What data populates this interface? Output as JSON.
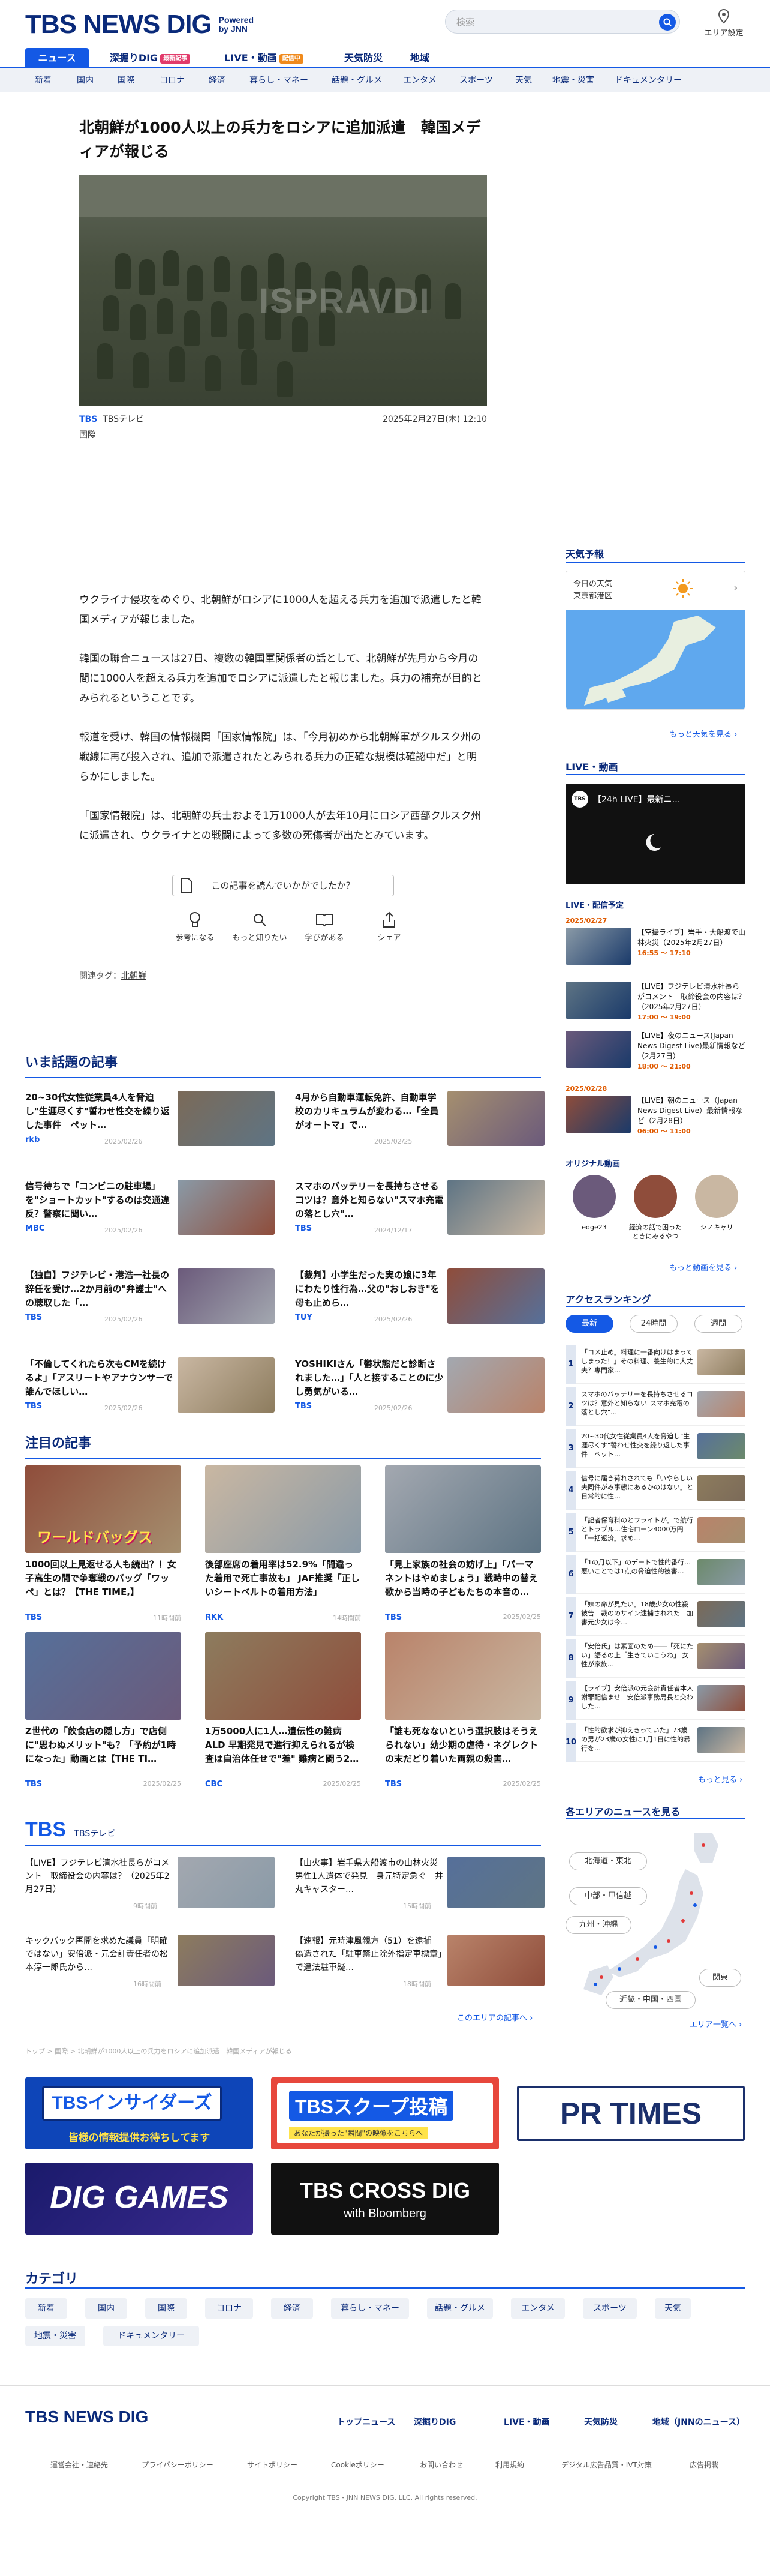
{
  "header": {
    "logo": "TBS NEWS DIG",
    "powered": "Powered by JNN",
    "search_placeholder": "検索",
    "area_label": "エリア設定"
  },
  "main_nav": [
    {
      "label": "ニュース"
    },
    {
      "label": "深掘りDIG",
      "badge": "最新記事"
    },
    {
      "label": "LIVE・動画",
      "badge": "配信中"
    },
    {
      "label": "天気防災"
    },
    {
      "label": "地域"
    }
  ],
  "sub_nav": [
    "新着",
    "国内",
    "国際",
    "コロナ",
    "経済",
    "暮らし・マネー",
    "話題・グルメ",
    "エンタメ",
    "スポーツ",
    "天気",
    "地震・災害",
    "ドキュメンタリー"
  ],
  "article": {
    "title": "北朝鮮が1000人以上の兵力をロシアに追加派遣　韓国メディアが報じる",
    "photo_watermark": "ISPRAVDI",
    "source": "TBSテレビ",
    "source_logo": "TBS",
    "date": "2025年2月27日(木) 12:10",
    "category": "国際",
    "paragraphs": [
      "ウクライナ侵攻をめぐり、北朝鮮がロシアに1000人を超える兵力を追加で派遣したと韓国メディアが報じました。",
      "韓国の聯合ニュースは27日、複数の韓国軍関係者の話として、北朝鮮が先月から今月の間に1000人を超える兵力を追加でロシアに派遣したと報じました。兵力の補充が目的とみられるということです。",
      "報道を受け、韓国の情報機関「国家情報院」は、「今月初めから北朝鮮軍がクルスク州の戦線に再び投入され、追加で派遣されたとみられる兵力の正確な規模は確認中だ」と明らかにしました。",
      "「国家情報院」は、北朝鮮の兵士およそ1万1000人が去年10月にロシア西部クルスク州に派遣され、ウクライナとの戦闘によって多数の死傷者が出たとみています。"
    ]
  },
  "feedback": {
    "question": "この記事を読んでいかがでしたか？",
    "options": [
      "参考になる",
      "もっと知りたい",
      "学びがある",
      "シェア"
    ]
  },
  "tags": {
    "label": "関連タグ：",
    "items": [
      "北朝鮮"
    ]
  },
  "trending": {
    "title": "いま話題の記事",
    "items": [
      {
        "title": "20~30代女性従業員4人を脅迫し\"生涯尽くす\"誓わせ性交を繰り返した事件　ペット…",
        "source": "rkb",
        "date": "2025/02/26"
      },
      {
        "title": "4月から自動車運転免許、自動車学校のカリキュラムが変わる…「全員がオートマ」で…",
        "source": "",
        "date": "2025/02/25"
      },
      {
        "title": "信号待ちで「コンビニの駐車場」を\"ショートカット\"するのは交通違反？警察に聞い…",
        "source": "MBC",
        "date": "2025/02/26"
      },
      {
        "title": "スマホのバッテリーを長持ちさせるコツは？意外と知らない\"スマホ充電の落とし穴\"…",
        "source": "TBS",
        "date": "2024/12/17"
      },
      {
        "title": "【独自】フジテレビ・港浩一社長の辞任を受け…2か月前の\"弁護士\"への聴取した「…",
        "source": "TBS",
        "date": "2025/02/26"
      },
      {
        "title": "【裁判】小学生だった実の娘に3年にわたり性行為…父の\"おしおき\"を母も止めら…",
        "source": "TUY",
        "date": "2025/02/26"
      },
      {
        "title": "「不倫してくれたら次もCMを続けるよ」「アスリートやアナウンサーで誰んでほしい…",
        "source": "TBS",
        "date": "2025/02/26"
      },
      {
        "title": "YOSHIKIさん「鬱状態だと診断されました…」「人と接することのに少し勇気がいる…",
        "source": "TBS",
        "date": "2025/02/26"
      }
    ]
  },
  "featured": {
    "title": "注目の記事",
    "items": [
      {
        "title": "1000回以上見返せる人も続出？！女子高生の間で争奪戦のバッグ「ワッペ」とは？【THE TIME,】",
        "source": "TBS",
        "date": "11時間前",
        "overlay": "ワールドバッグス"
      },
      {
        "title": "後部座席の着用率は52.9%「間違った着用で死亡事故も」 JAF推奨「正しいシートベルトの着用方法」",
        "source": "RKK",
        "date": "14時間前",
        "overlay": ""
      },
      {
        "title": "「見上家族の社会の妨げ上」「パーマネントはやめましょう」戦時中の替え歌から当時の子どもたちの本音の…",
        "source": "TBS",
        "date": "2025/02/25",
        "overlay": ""
      },
      {
        "title": "Z世代の「飲食店の隠し方」で店側に\"思わぬメリット\"も？「予約が1時になった」動画とは【THE TI…",
        "source": "TBS",
        "date": "2025/02/25",
        "overlay": ""
      },
      {
        "title": "1万5000人に1人…遺伝性の難病ALD 早期発見で進行抑えられるが検査は自治体任せで\"差\" 難病と闘う2…",
        "source": "CBC",
        "date": "2025/02/25",
        "overlay": ""
      },
      {
        "title": "「誰も死なないという選択肢はそうえられない」幼少期の虐待・ネグレクトの末だどり着いた両親の殺害…",
        "source": "TBS",
        "date": "2025/02/25",
        "overlay": ""
      }
    ]
  },
  "tbs_section": {
    "logo": "TBS",
    "label": "TBSテレビ",
    "items": [
      {
        "title": "【LIVE】フジテレビ清水社長らがコメント　取締役会の内容は？（2025年2月27日）",
        "date": "9時間前"
      },
      {
        "title": "【山火事】岩手県大船渡市の山林火災　男性1人遺体で発見　身元特定急ぐ　井丸キャスター…",
        "date": "15時間前"
      },
      {
        "title": "キックバック再開を求めた議員「明確ではない」安倍派・元会計責任者の松本淳一郎氏から…",
        "date": "16時間前"
      },
      {
        "title": "【速報】元時津風親方（51）を逮捕　偽造された「駐車禁止除外指定車標章」で違法駐車疑…",
        "date": "18時間前"
      }
    ],
    "more": "このエリアの記事へ"
  },
  "breadcrumb": "トップ > 国際 > 北朝鮮が1000人以上の兵力をロシアに追加派遣　韓国メディアが報じる",
  "banners": [
    {
      "title": "TBSインサイダーズ",
      "sub": "皆様の情報提供お待ちしてます"
    },
    {
      "title": "TBSスクープ投稿",
      "sub": "あなたが撮った\"瞬間\"の映像をこちらへ"
    },
    {
      "title": "PR TIMES",
      "sub": ""
    },
    {
      "title": "DIG GAMES",
      "sub": ""
    },
    {
      "title": "TBS CROSS DIG",
      "sub": "with Bloomberg"
    }
  ],
  "categories": {
    "title": "カテゴリ",
    "items": [
      "新着",
      "国内",
      "国際",
      "コロナ",
      "経済",
      "暮らし・マネー",
      "話題・グルメ",
      "エンタメ",
      "スポーツ",
      "天気",
      "地震・災害",
      "ドキュメンタリー"
    ]
  },
  "sidebar": {
    "weather": {
      "title": "天気予報",
      "today": "今日の天気",
      "place": "東京都港区",
      "more": "もっと天気を見る"
    },
    "live": {
      "title": "LIVE・動画",
      "video_title": "【24h LIVE】最新ニ…",
      "schedule_title": "LIVE・配信予定",
      "schedule": [
        {
          "date": "2025/02/27",
          "title": "【空撮ライブ】岩手・大船渡で山林火災（2025年2月27日）",
          "time": "16:55 ～ 17:10"
        },
        {
          "date": "",
          "title": "【LIVE】フジテレビ清水社長らがコメント　取締役会の内容は？（2025年2月27日）",
          "time": "17:00 ～ 19:00"
        },
        {
          "date": "",
          "title": "【LIVE】夜のニュース(Japan News Digest Live)最新情報など（2月27日）",
          "time": "18:00 ～ 21:00"
        },
        {
          "date": "2025/02/28",
          "title": "【LIVE】朝のニュース（Japan News Digest Live）最新情報など（2月28日）",
          "time": "06:00 ～ 11:00"
        }
      ],
      "original_title": "オリジナル動画",
      "originals": [
        "edge23",
        "経済の話で困ったときにみるやつ",
        "シノキャリ"
      ],
      "more": "もっと動画を見る"
    },
    "ranking": {
      "title": "アクセスランキング",
      "tabs": [
        "最新",
        "24時間",
        "週間"
      ],
      "items": [
        "「コメ止め」料理に一番向けはまってしまった！」その料理、養生的に大丈夫？専門家…",
        "スマホのバッテリーを長持ちさせるコツは？意外と知らない\"スマホ充電の落とし穴\"…",
        "20~30代女性従業員4人を脅迫し\"生涯尽くす\"誓わせ性交を繰り返した事件　ペット…",
        "信号に届き荷れされても「いやらしい夫同件がみ事態にあるかのはない」と日常的に性…",
        "「記者保育料のとフライトが」で航行とトラブル…住宅ローン4000万円「一括返済」求め…",
        "「1の月以下」のデートで性的番行…悪いことでは1点の脅迫性的被害…",
        "「妹の命が見たい」18歳少女の性殺被告　裁ののサイン逮捕されれた　加害元少女は今…",
        "「安倍氏」は素面のため――「死にたい」語るの上「生きていこうね」 女性が家族…",
        "【ライブ】安倍派の元会計責任者本人謝罪配信ませ　安倍派事務局長と交わした…",
        "「性的欲求が抑えきっていた」73歳の男が23歳の女性に1月1日に性的暴行を…"
      ],
      "more": "もっと見る"
    },
    "area": {
      "title": "各エリアのニュースを見る",
      "regions": [
        "北海道・東北",
        "中部・甲信越",
        "九州・沖縄",
        "関東",
        "近畿・中国・四国"
      ],
      "more": "エリア一覧へ"
    }
  },
  "footer": {
    "nav": [
      "トップニュース",
      "深掘りDIG",
      "LIVE・動画",
      "天気防災",
      "地域（JNNのニュース）"
    ],
    "links": [
      "運営会社・連絡先",
      "プライバシーポリシー",
      "サイトポリシー",
      "Cookieポリシー",
      "お問い合わせ",
      "利用規約",
      "デジタル広告品質・IVT対策",
      "広告掲載"
    ],
    "copyright": "Copyright TBS・JNN NEWS DIG, LLC. All rights reserved."
  }
}
